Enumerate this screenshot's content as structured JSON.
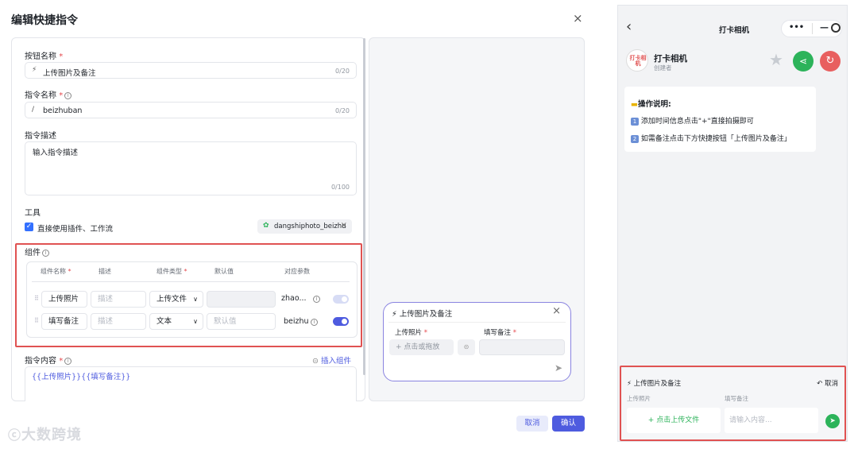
{
  "dialog": {
    "title": "编辑快捷指令",
    "close": "×",
    "button_name_label": "按钮名称",
    "button_name_value": "上传图片及备注",
    "button_name_count": "0/20",
    "cmd_name_label": "指令名称",
    "cmd_name_value": "beizhuban",
    "cmd_name_prefix": "/",
    "cmd_name_count": "0/20",
    "cmd_desc_label": "指令描述",
    "cmd_desc_placeholder": "输入指令描述",
    "cmd_desc_count": "0/100",
    "tools_label": "工具",
    "direct_use_label": "直接使用插件、工作流",
    "tool_chip": "dangshiphoto_beizhu",
    "components_label": "组件",
    "table_headers": [
      "组件名称",
      "描述",
      "组件类型",
      "默认值",
      "对应参数"
    ],
    "rows": [
      {
        "name": "上传照片",
        "desc_placeholder": "描述",
        "type": "上传文件",
        "default": "",
        "param": "zhao...",
        "enabled": false
      },
      {
        "name": "填写备注",
        "desc_placeholder": "描述",
        "type": "文本",
        "default_placeholder": "默认值",
        "param": "beizhu",
        "enabled": true
      }
    ],
    "content_label": "指令内容",
    "insert_component": "插入组件",
    "content_value": "{{上传照片}}{{填写备注}}",
    "cancel": "取消",
    "confirm": "确认"
  },
  "preview": {
    "title": "上传图片及备注",
    "field1_label": "上传照片",
    "field2_label": "填写备注",
    "upload_text": "+ 点击或拖放"
  },
  "watermark": "大数跨境",
  "phone": {
    "back": "‹",
    "title": "打卡相机",
    "menu": "•••",
    "bot_name": "打卡相机",
    "bot_sub": "创建者",
    "logo_text": "打卡相机",
    "info_title": "操作说明:",
    "info_line1": "添加时间信息点击\"+\"直接拍摄即可",
    "info_line2": "如需备注点击下方快捷按钮「上传图片及备注」",
    "num1": "1",
    "num2": "2",
    "panel_title": "上传图片及备注",
    "panel_cancel": "取消",
    "col1": "上传照片",
    "col2": "填写备注",
    "upload_btn": "+ 点击上传文件",
    "input_placeholder": "请输入内容..."
  },
  "colors": {
    "accent": "#3370ff",
    "purple": "#4e5bdf",
    "red_box": "#e05252",
    "green": "#2cb35a"
  }
}
